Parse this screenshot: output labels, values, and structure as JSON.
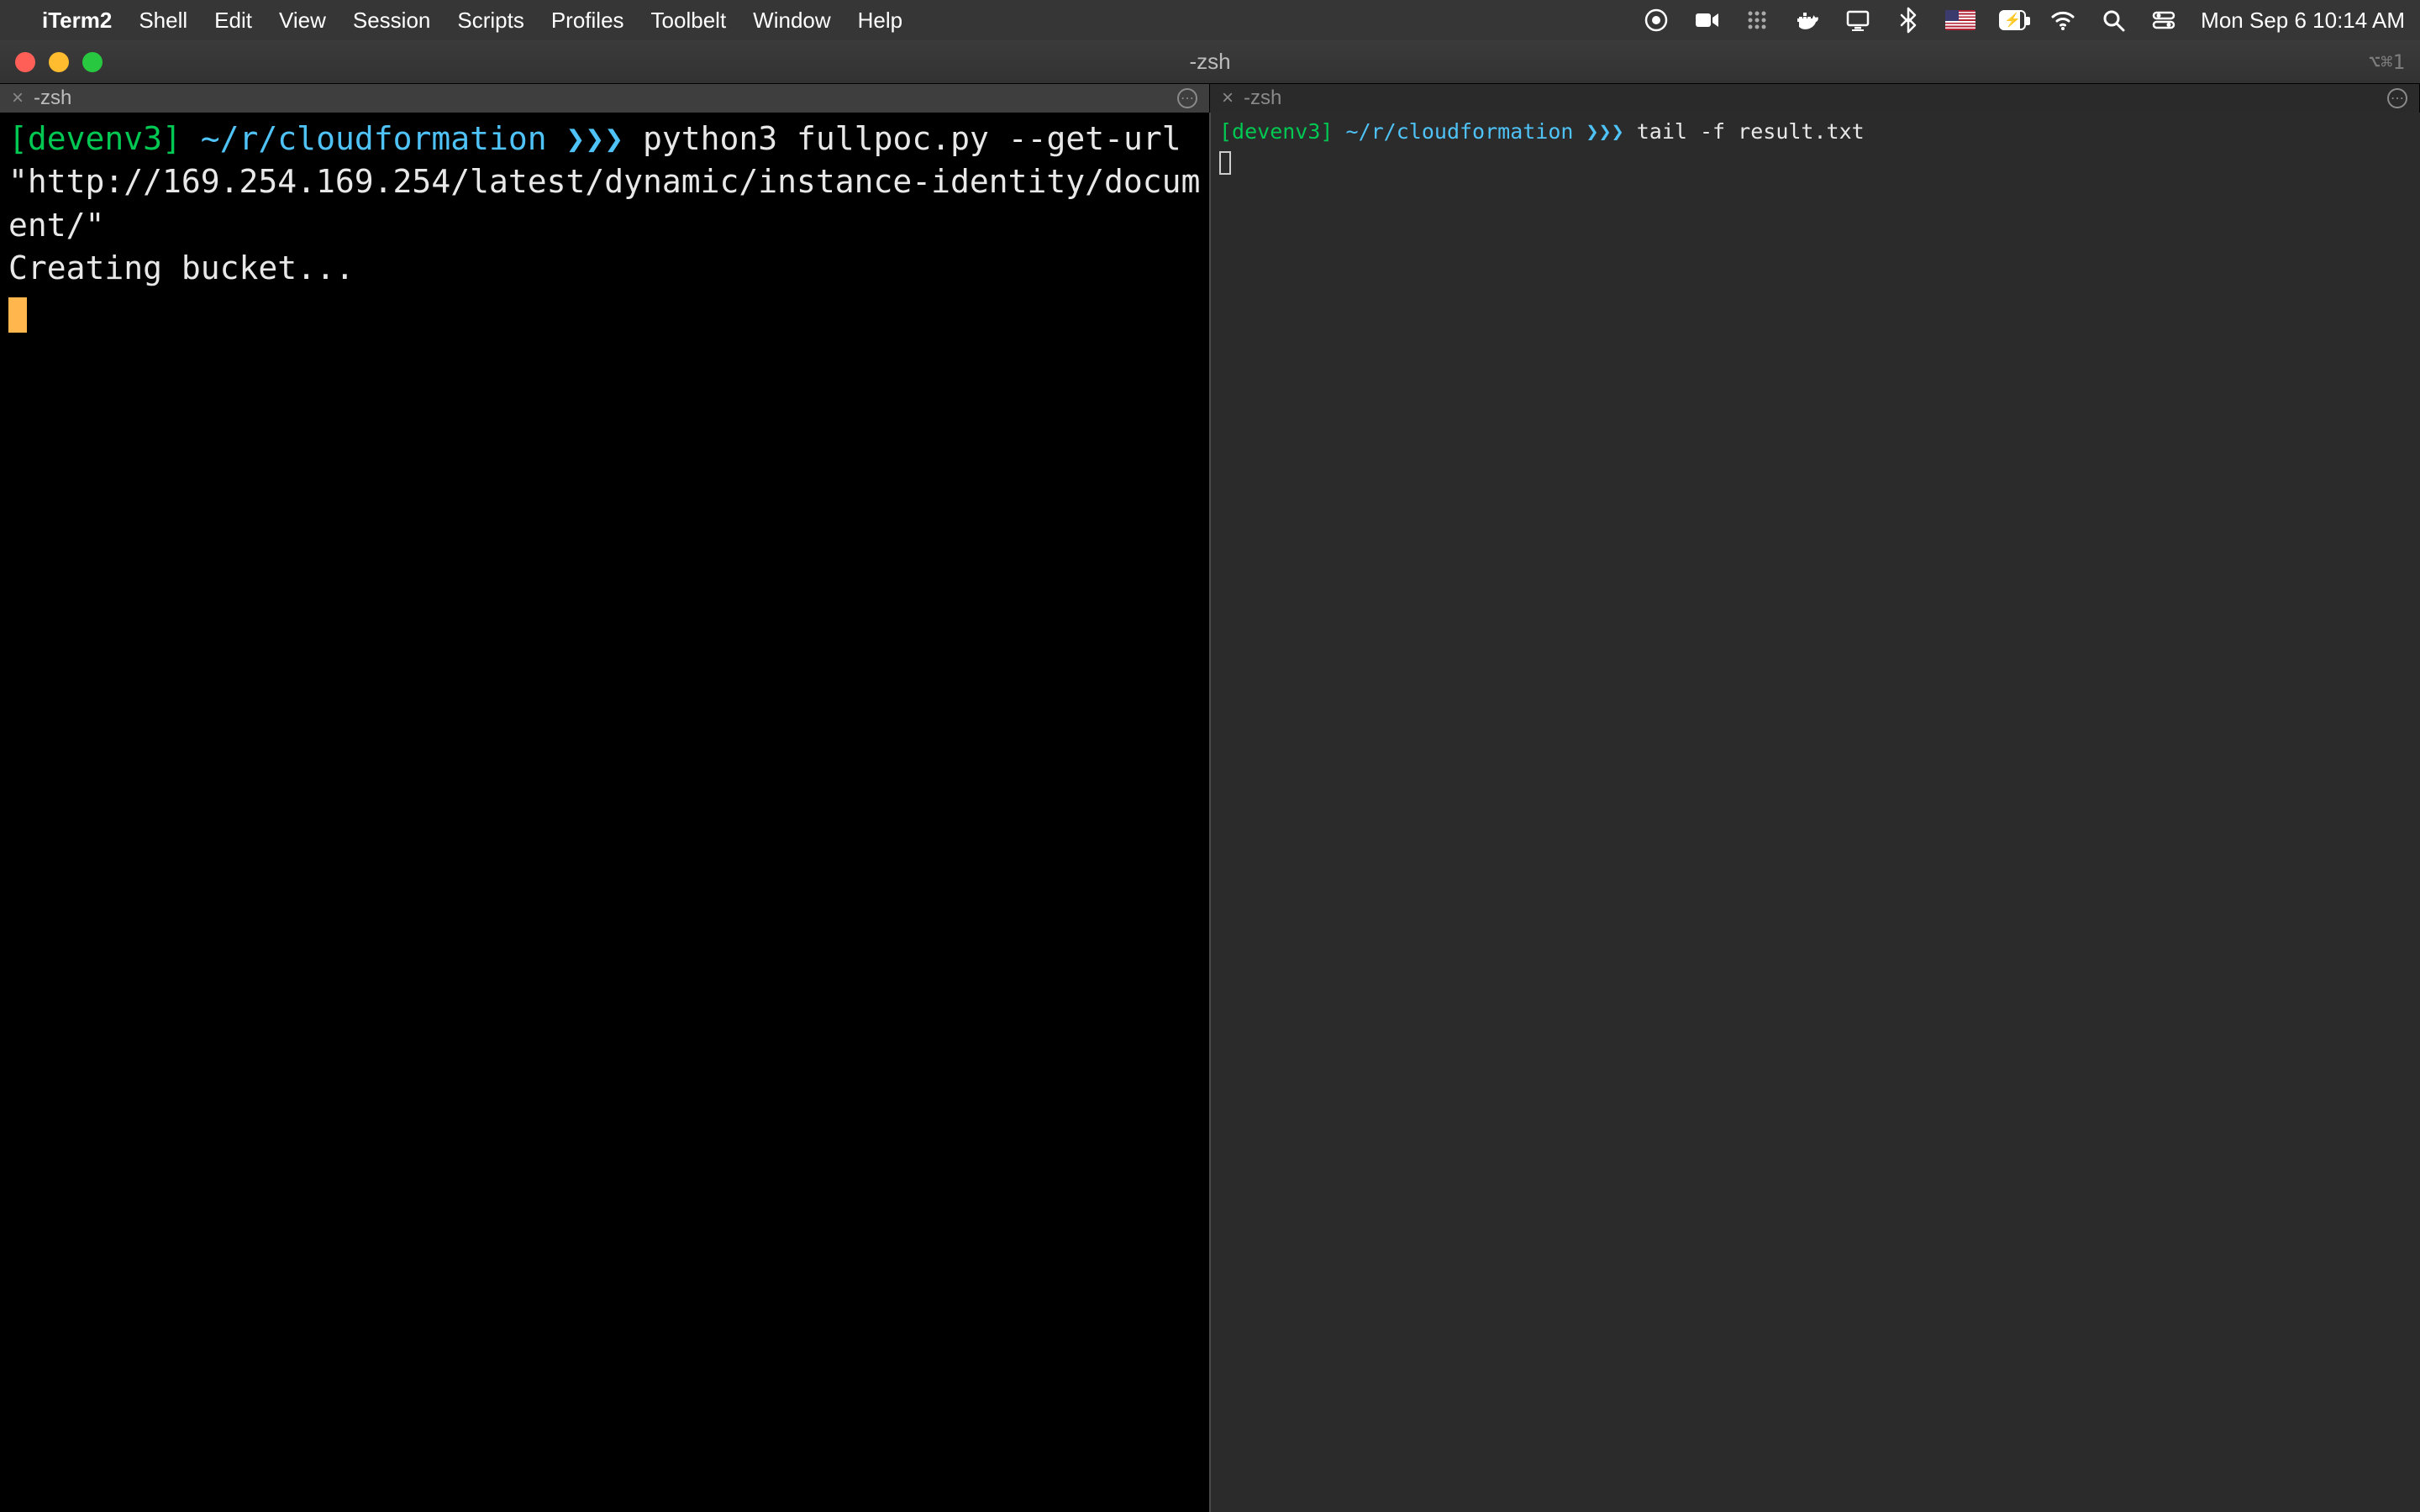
{
  "menubar": {
    "app_name": "iTerm2",
    "items": [
      "Shell",
      "Edit",
      "View",
      "Session",
      "Scripts",
      "Profiles",
      "Toolbelt",
      "Window",
      "Help"
    ],
    "clock": "Mon Sep 6  10:14 AM"
  },
  "window": {
    "title": "-zsh",
    "badge": "⌥⌘1"
  },
  "tabs": [
    {
      "label": "-zsh",
      "active": true
    },
    {
      "label": "-zsh",
      "active": false
    }
  ],
  "left_pane": {
    "env": "[devenv3]",
    "path": "~/r/cloudformation",
    "arrows": "❯❯❯",
    "command": "python3 fullpoc.py --get-url \"http://169.254.169.254/latest/dynamic/instance-identity/document/\"",
    "output_line1": "Creating bucket..."
  },
  "right_pane": {
    "env": "[devenv3]",
    "path": "~/r/cloudformation",
    "arrows": "❯❯❯",
    "command": "tail -f result.txt"
  },
  "icons": {
    "apple": "",
    "bluetooth": "bluetooth-icon",
    "wifi": "wifi-icon",
    "search": "search-icon",
    "control_center": "control-center-icon",
    "screen_record": "screen-record-icon",
    "facetime": "facetime-icon",
    "grid": "grid-icon",
    "docker": "docker-icon",
    "display": "display-icon"
  }
}
